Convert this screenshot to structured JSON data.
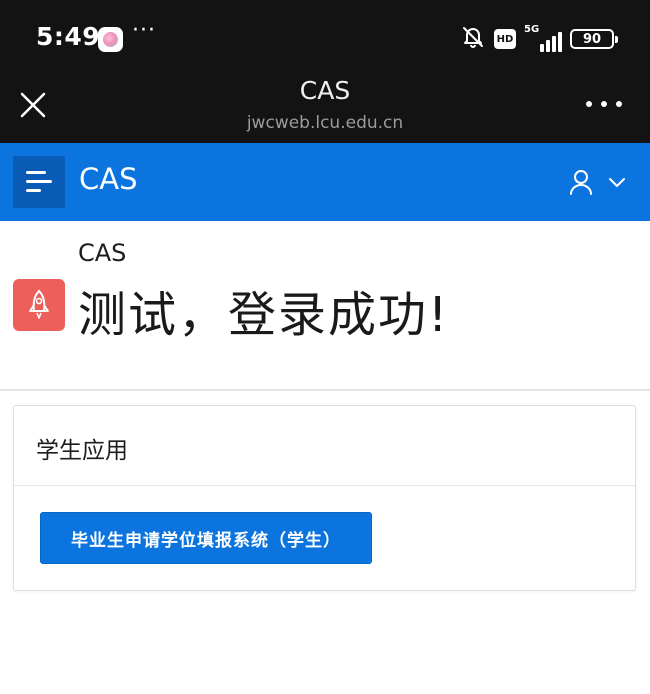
{
  "status_bar": {
    "time": "5:49",
    "more": "···",
    "hd": "HD",
    "network": "5G",
    "battery": "90"
  },
  "title_bar": {
    "title": "CAS",
    "domain": "jwcweb.lcu.edu.cn"
  },
  "app_header": {
    "brand": "CAS"
  },
  "welcome": {
    "app_label": "CAS",
    "heading": "测试，登录成功!"
  },
  "panel": {
    "title": "学生应用",
    "button_label": "毕业生申请学位填报系统（学生）"
  },
  "colors": {
    "status_bg": "#131313",
    "brand_blue": "#0b74df",
    "brand_blue_dark": "#0a5bb5",
    "rocket_red": "#ec5f5b"
  },
  "icons": {
    "status_app": "app-logo-icon",
    "mute": "bell-off-icon",
    "close": "close-icon",
    "more": "more-dots-icon",
    "menu": "menu-icon",
    "user": "user-icon",
    "chevron": "chevron-down-icon",
    "rocket": "rocket-icon"
  }
}
